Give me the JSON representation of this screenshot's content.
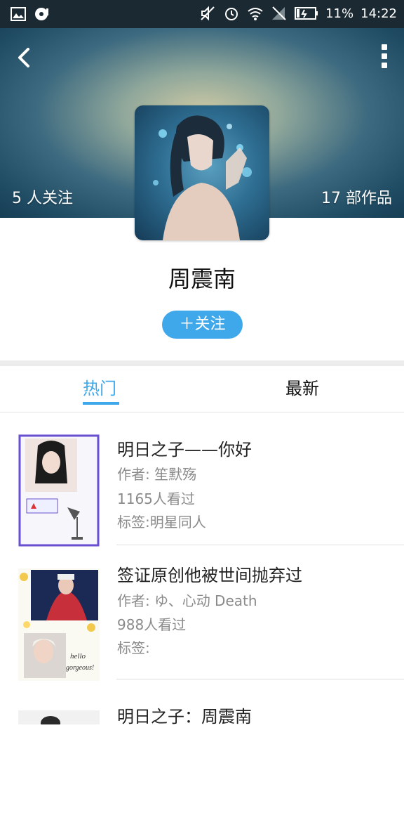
{
  "status_bar": {
    "battery": "11%",
    "time": "14:22"
  },
  "header": {
    "followers": "5 人关注",
    "works": "17 部作品"
  },
  "profile": {
    "name": "周震南",
    "follow_label": "＋关注"
  },
  "tabs": [
    {
      "label": "热门"
    },
    {
      "label": "最新"
    }
  ],
  "stories": [
    {
      "title": "明日之子——你好",
      "author": "作者: 笙默殇",
      "views": "1165人看过",
      "tags": "标签:明星同人"
    },
    {
      "title": "签证原创他被世间抛弃过",
      "author": "作者: ゆ、心动 Death",
      "views": "988人看过",
      "tags": "标签:"
    },
    {
      "title": "明日之子：周震南"
    }
  ],
  "colors": {
    "accent": "#3fa8ea",
    "status_bar": "#1b2a32"
  }
}
